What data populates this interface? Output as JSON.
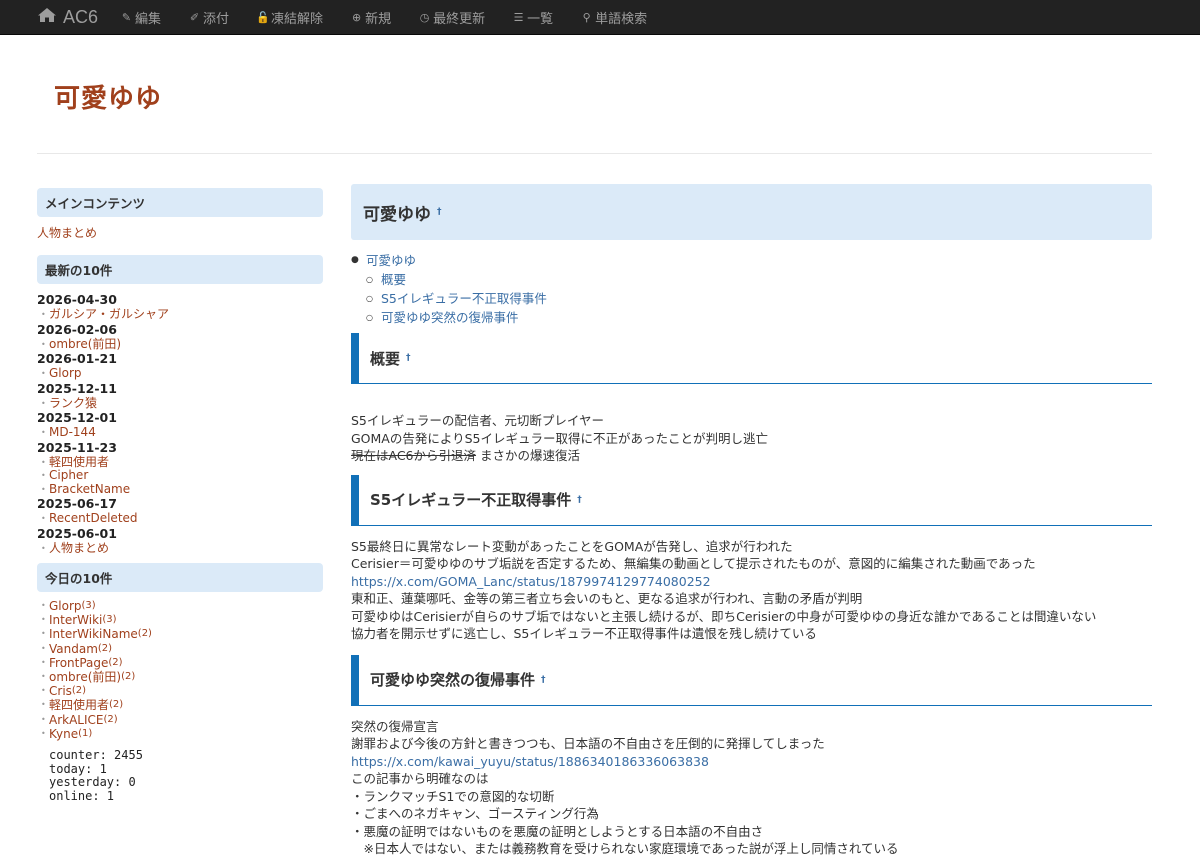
{
  "nav": {
    "brand": "AC6",
    "items": [
      {
        "icon": "edit-icon",
        "glyph": "✎",
        "label": "編集"
      },
      {
        "icon": "attach-icon",
        "glyph": "✐",
        "label": "添付"
      },
      {
        "icon": "unlock-icon",
        "glyph": "🔓",
        "label": "凍結解除"
      },
      {
        "icon": "plus-circle-icon",
        "glyph": "⊕",
        "label": "新規"
      },
      {
        "icon": "clock-icon",
        "glyph": "◷",
        "label": "最終更新"
      },
      {
        "icon": "list-icon",
        "glyph": "☰",
        "label": "一覧"
      },
      {
        "icon": "search-icon",
        "glyph": "⚲",
        "label": "単語検索"
      }
    ]
  },
  "site_title": "可愛ゆゆ",
  "sidebar": {
    "main_contents": {
      "heading": "メインコンテンツ",
      "link": "人物まとめ"
    },
    "latest": {
      "heading": "最新の10件",
      "groups": [
        {
          "date": "2026-04-30",
          "items": [
            "ガルシア・ガルシャア"
          ]
        },
        {
          "date": "2026-02-06",
          "items": [
            "ombre(前田)"
          ]
        },
        {
          "date": "2026-01-21",
          "items": [
            "Glorp"
          ]
        },
        {
          "date": "2025-12-11",
          "items": [
            "ランク猿"
          ]
        },
        {
          "date": "2025-12-01",
          "items": [
            "MD-144"
          ]
        },
        {
          "date": "2025-11-23",
          "items": [
            "軽四使用者",
            "Cipher",
            "BracketName"
          ]
        },
        {
          "date": "2025-06-17",
          "items": [
            "RecentDeleted"
          ]
        },
        {
          "date": "2025-06-01",
          "items": [
            "人物まとめ"
          ]
        }
      ]
    },
    "today": {
      "heading": "今日の10件",
      "items": [
        {
          "name": "Glorp",
          "count": "(3)"
        },
        {
          "name": "InterWiki",
          "count": "(3)"
        },
        {
          "name": "InterWikiName",
          "count": "(2)"
        },
        {
          "name": "Vandam",
          "count": "(2)"
        },
        {
          "name": "FrontPage",
          "count": "(2)"
        },
        {
          "name": "ombre(前田)",
          "count": "(2)"
        },
        {
          "name": "Cris",
          "count": "(2)"
        },
        {
          "name": "軽四使用者",
          "count": "(2)"
        },
        {
          "name": "ArkALICE",
          "count": "(2)"
        },
        {
          "name": "Kyne",
          "count": "(1)"
        }
      ]
    },
    "counter": {
      "counter": "counter: 2455",
      "today": "today: 1",
      "yesterday": "yesterday: 0",
      "online": "online: 1"
    }
  },
  "main": {
    "title": "可愛ゆゆ",
    "anchor": "†",
    "toc": {
      "top": "可愛ゆゆ",
      "children": [
        "概要",
        "S5イレギュラー不正取得事件",
        "可愛ゆゆ突然の復帰事件"
      ]
    },
    "sections": [
      {
        "heading": "概要",
        "lines": [
          {
            "text": "S5イレギュラーの配信者、元切断プレイヤー"
          },
          {
            "text": "GOMAの告発によりS5イレギュラー取得に不正があったことが判明し逃亡"
          },
          {
            "strike": "現在はAC6から引退済",
            "text": " まさかの爆速復活"
          }
        ]
      },
      {
        "heading": "S5イレギュラー不正取得事件",
        "lines": [
          {
            "text": "S5最終日に異常なレート変動があったことをGOMAが告発し、追求が行われた"
          },
          {
            "text": "Cerisier＝可愛ゆゆのサブ垢説を否定するため、無編集の動画として提示されたものが、意図的に編集された動画であった"
          },
          {
            "link": "https://x.com/GOMA_Lanc/status/1879974129774080252"
          },
          {
            "text": "東和正、蓮葉哪吒、金等の第三者立ち会いのもと、更なる追求が行われ、言動の矛盾が判明"
          },
          {
            "text": "可愛ゆゆはCerisierが自らのサブ垢ではないと主張し続けるが、即ちCerisierの中身が可愛ゆゆの身近な誰かであることは間違いない"
          },
          {
            "text": "協力者を開示せずに逃亡し、S5イレギュラー不正取得事件は遺恨を残し続けている"
          }
        ]
      },
      {
        "heading": "可愛ゆゆ突然の復帰事件",
        "lines": [
          {
            "text": "突然の復帰宣言"
          },
          {
            "text": "謝罪および今後の方針と書きつつも、日本語の不自由さを圧倒的に発揮してしまった"
          },
          {
            "link": "https://x.com/kawai_yuyu/status/1886340186336063838"
          },
          {
            "text": "この記事から明確なのは"
          },
          {
            "text": "・ランクマッチS1での意図的な切断"
          },
          {
            "text": "・ごまへのネガキャン、ゴースティング行為"
          },
          {
            "text": "・悪魔の証明ではないものを悪魔の証明としようとする日本語の不自由さ"
          },
          {
            "text": "　※日本人ではない、または義務教育を受けられない家庭環境であった説が浮上し同情されている"
          }
        ]
      }
    ]
  }
}
